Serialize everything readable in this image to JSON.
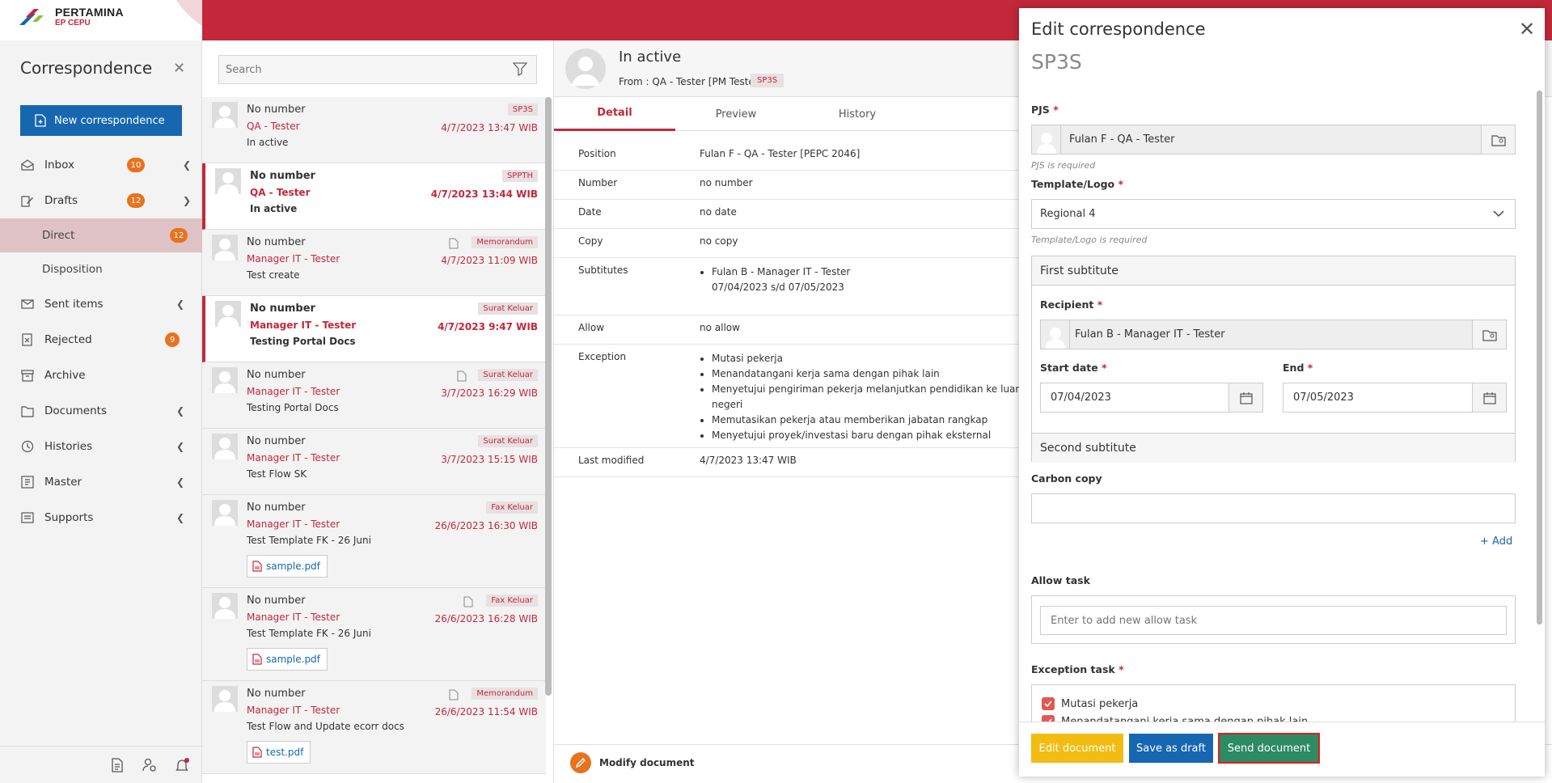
{
  "brand": {
    "name": "PERTAMINA",
    "unit": "EP CEPU"
  },
  "sidebar": {
    "title": "Correspondence",
    "new_button": "New correspondence",
    "items": [
      {
        "label": "Inbox",
        "badge": "10"
      },
      {
        "label": "Drafts",
        "badge": "12"
      },
      {
        "label": "Direct",
        "badge": "12"
      },
      {
        "label": "Disposition"
      },
      {
        "label": "Sent items"
      },
      {
        "label": "Rejected",
        "badge": "9"
      },
      {
        "label": "Archive"
      },
      {
        "label": "Documents"
      },
      {
        "label": "Histories"
      },
      {
        "label": "Master"
      },
      {
        "label": "Supports"
      }
    ]
  },
  "list": {
    "search_placeholder": "Search",
    "items": [
      {
        "number": "No number",
        "from": "QA - Tester",
        "subject": "In active",
        "tag": "SP3S",
        "date": "4/7/2023 13:47 WIB"
      },
      {
        "number": "No number",
        "from": "QA - Tester",
        "subject": "In active",
        "tag": "SPPTH",
        "date": "4/7/2023 13:44 WIB"
      },
      {
        "number": "No number",
        "from": "Manager IT - Tester",
        "subject": "Test create",
        "tag": "Memorandum",
        "date": "4/7/2023 11:09 WIB"
      },
      {
        "number": "No number",
        "from": "Manager IT - Tester",
        "subject": "Testing Portal Docs",
        "tag": "Surat Keluar",
        "date": "4/7/2023 9:47 WIB"
      },
      {
        "number": "No number",
        "from": "Manager IT - Tester",
        "subject": "Testing Portal Docs",
        "tag": "Surat Keluar",
        "date": "3/7/2023 16:29 WIB"
      },
      {
        "number": "No number",
        "from": "Manager IT - Tester",
        "subject": "Test Flow SK",
        "tag": "Surat Keluar",
        "date": "3/7/2023 15:15 WIB"
      },
      {
        "number": "No number",
        "from": "Manager IT - Tester",
        "subject": "Test Template FK - 26 Juni",
        "tag": "Fax Keluar",
        "date": "26/6/2023 16:30 WIB",
        "attachment": "sample.pdf"
      },
      {
        "number": "No number",
        "from": "Manager IT - Tester",
        "subject": "Test Template FK - 26 Juni",
        "tag": "Fax Keluar",
        "date": "26/6/2023 16:28 WIB",
        "attachment": "sample.pdf"
      },
      {
        "number": "No number",
        "from": "Manager IT - Tester",
        "subject": "Test Flow and Update ecorr docs",
        "tag": "Memorandum",
        "date": "26/6/2023 11:54 WIB",
        "attachment": "test.pdf"
      }
    ]
  },
  "detail": {
    "title": "In active",
    "from": "From : QA - Tester [PM Tester]",
    "tag": "SP3S",
    "tabs": [
      "Detail",
      "Preview",
      "History"
    ],
    "rows": {
      "position": {
        "k": "Position",
        "v": "Fulan F - QA - Tester [PEPC 2046]"
      },
      "number": {
        "k": "Number",
        "v": "no number"
      },
      "date": {
        "k": "Date",
        "v": "no date"
      },
      "copy": {
        "k": "Copy",
        "v": "no copy"
      },
      "subtitutes": {
        "k": "Subtitutes",
        "v1": "Fulan B - Manager IT - Tester",
        "v2": "07/04/2023 s/d 07/05/2023"
      },
      "allow": {
        "k": "Allow",
        "v": "no allow"
      },
      "exception": {
        "k": "Exception",
        "items": [
          "Mutasi pekerja",
          "Menandatangani kerja sama dengan pihak lain",
          "Menyetujui pengiriman pekerja melanjutkan pendidikan ke luar negeri",
          "Memutasikan pekerja atau memberikan jabatan rangkap",
          "Menyetujui proyek/investasi baru dengan pihak eksternal"
        ]
      },
      "modified": {
        "k": "Last modified",
        "v": "4/7/2023 13:47 WIB"
      }
    },
    "modify": "Modify document"
  },
  "modal": {
    "title": "Edit correspondence",
    "subtitle": "SP3S",
    "pjs_label": "PJS",
    "pjs_value": "Fulan F - QA - Tester",
    "pjs_hint": "PJS is required",
    "template_label": "Template/Logo",
    "template_value": "Regional 4",
    "template_hint": "Template/Logo is required",
    "first_subtitute": "First subtitute",
    "recipient_label": "Recipient",
    "recipient_value": "Fulan B - Manager IT - Tester",
    "start_label": "Start date",
    "start_value": "07/04/2023",
    "end_label": "End",
    "end_value": "07/05/2023",
    "second_subtitute": "Second subtitute",
    "cc_label": "Carbon copy",
    "add_label": "Add",
    "allow_label": "Allow task",
    "allow_placeholder": "Enter to add new allow task",
    "exception_label": "Exception task",
    "exceptions": [
      "Mutasi pekerja",
      "Menandatangani kerja sama dengan pihak lain"
    ],
    "btn_edit": "Edit document",
    "btn_draft": "Save as draft",
    "btn_send": "Send document"
  },
  "colors": {
    "brand_red": "#c3283a",
    "primary_blue": "#1667b0",
    "badge_orange": "#e8731e",
    "edit_yellow": "#f2bc13",
    "send_green": "#2d8a63"
  }
}
